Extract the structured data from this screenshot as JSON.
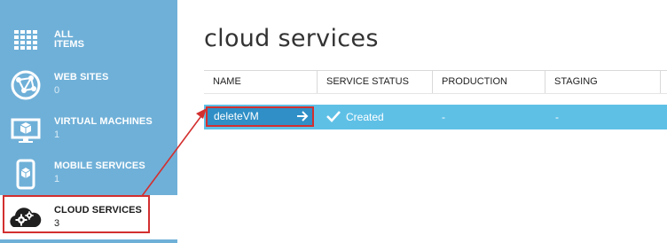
{
  "sidebar": {
    "items": [
      {
        "label_line1": "ALL",
        "label_line2": "ITEMS",
        "icon": "grid-icon"
      },
      {
        "label": "WEB SITES",
        "count": "0",
        "icon": "globe-network-icon"
      },
      {
        "label": "VIRTUAL MACHINES",
        "count": "1",
        "icon": "monitor-cube-icon"
      },
      {
        "label": "MOBILE SERVICES",
        "count": "1",
        "icon": "phone-cube-icon"
      },
      {
        "label": "CLOUD SERVICES",
        "count": "3",
        "icon": "cloud-gears-icon",
        "active": true
      }
    ]
  },
  "main": {
    "title": "cloud services",
    "columns": [
      "NAME",
      "SERVICE STATUS",
      "PRODUCTION",
      "STAGING"
    ],
    "rows": [
      {
        "name": "deleteVM",
        "status": "Created",
        "production": "-",
        "staging": "-"
      }
    ]
  },
  "colors": {
    "sidebar_bg": "#6fb0d8",
    "row_selected": "#5fc0e6",
    "name_cell": "#2f8fc6",
    "annotation": "#d32f2f"
  }
}
